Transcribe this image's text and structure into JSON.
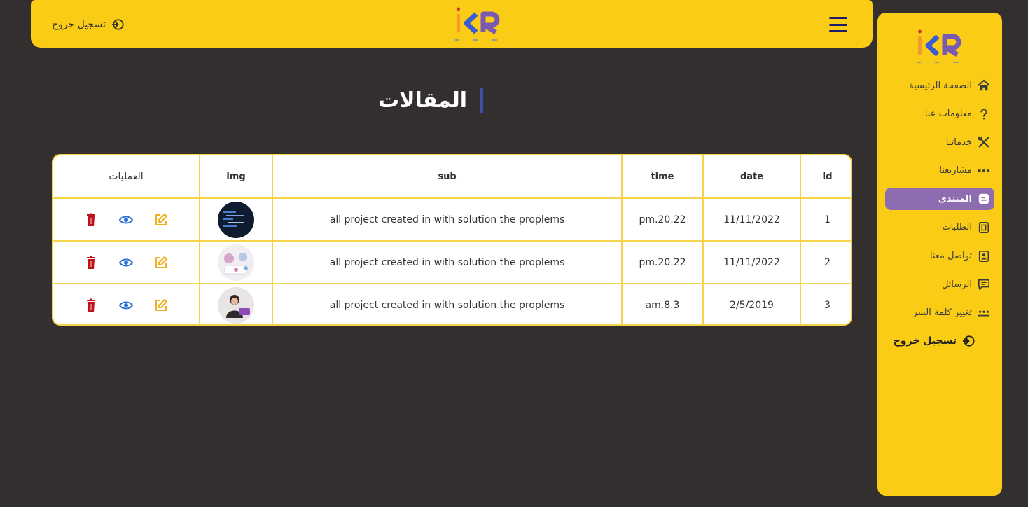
{
  "header": {
    "logout_label": "تسجيل خروج"
  },
  "sidebar": {
    "items": [
      {
        "label": "الصفحة الرئيسية",
        "icon": "home-icon"
      },
      {
        "label": "معلومات عنا",
        "icon": "question-icon"
      },
      {
        "label": "خدماتنا",
        "icon": "tools-icon"
      },
      {
        "label": "مشاريعنا",
        "icon": "dots-icon"
      },
      {
        "label": "المنتدى",
        "icon": "blog-icon",
        "active": true
      },
      {
        "label": "الطلبات",
        "icon": "orders-icon"
      },
      {
        "label": "تواصل معنا",
        "icon": "contact-icon"
      },
      {
        "label": "الرسائل",
        "icon": "messages-icon"
      },
      {
        "label": "تغيير كلمة السر",
        "icon": "password-icon"
      }
    ],
    "logout_label": "تسجيل خروج"
  },
  "main": {
    "title": "المقالات"
  },
  "table": {
    "columns": [
      "Id",
      "date",
      "time",
      "sub",
      "img",
      "العمليات"
    ],
    "rows": [
      {
        "id": "1",
        "date": "11/11/2022",
        "time": "pm.20.22",
        "sub": "all project created in with solution the proplems"
      },
      {
        "id": "2",
        "date": "11/11/2022",
        "time": "pm.20.22",
        "sub": "all project created in with solution the proplems"
      },
      {
        "id": "3",
        "date": "2/5/2019",
        "time": "am.8.3",
        "sub": "all project created in with solution the proplems"
      }
    ]
  },
  "colors": {
    "accent_yellow": "#facc15",
    "active_purple": "#8e6cb0",
    "background": "#332f2e",
    "edit": "#f2b01e",
    "view": "#2f6fd6",
    "delete": "#c0121a"
  }
}
